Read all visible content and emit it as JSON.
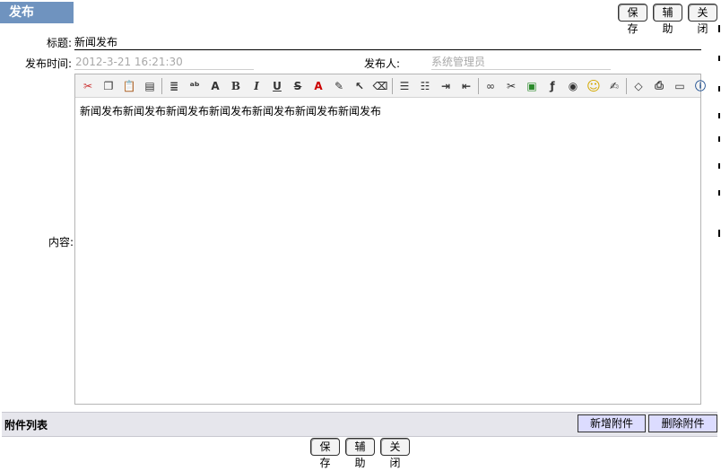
{
  "window": {
    "title": "发布"
  },
  "toolbar_top": {
    "save": "保存",
    "assist": "辅助",
    "close": "关闭"
  },
  "form": {
    "title_label": "标题:",
    "title_value": "新闻发布",
    "time_label": "发布时间:",
    "time_value": "2012-3-21 16:21:30",
    "publisher_label": "发布人:",
    "publisher_value": "系统管理员",
    "content_label": "内容:"
  },
  "editor": {
    "text": "新闻发布新闻发布新闻发布新闻发布新闻发布新闻发布新闻发布",
    "tools": [
      "cut-icon",
      "copy-icon",
      "paste-icon",
      "paste-text-icon",
      "sep",
      "line-spacing-icon",
      "spellcheck-icon",
      "font-size-icon",
      "bold-icon",
      "italic-icon",
      "underline-icon",
      "strikethrough-icon",
      "font-color-icon",
      "highlight-icon",
      "select-icon",
      "eraser-icon",
      "sep",
      "align-icon",
      "bullet-list-icon",
      "indent-icon",
      "outdent-icon",
      "sep",
      "link-icon",
      "unlink-icon",
      "image-icon",
      "flash-icon",
      "media-icon",
      "emoticon-icon",
      "edit-icon",
      "sep",
      "source-code-icon",
      "print-icon",
      "preview-icon",
      "about-icon"
    ]
  },
  "attachments": {
    "title": "附件列表",
    "add": "新增附件",
    "delete": "删除附件"
  },
  "toolbar_bottom": {
    "save": "保存",
    "assist": "辅助",
    "close": "关闭"
  }
}
